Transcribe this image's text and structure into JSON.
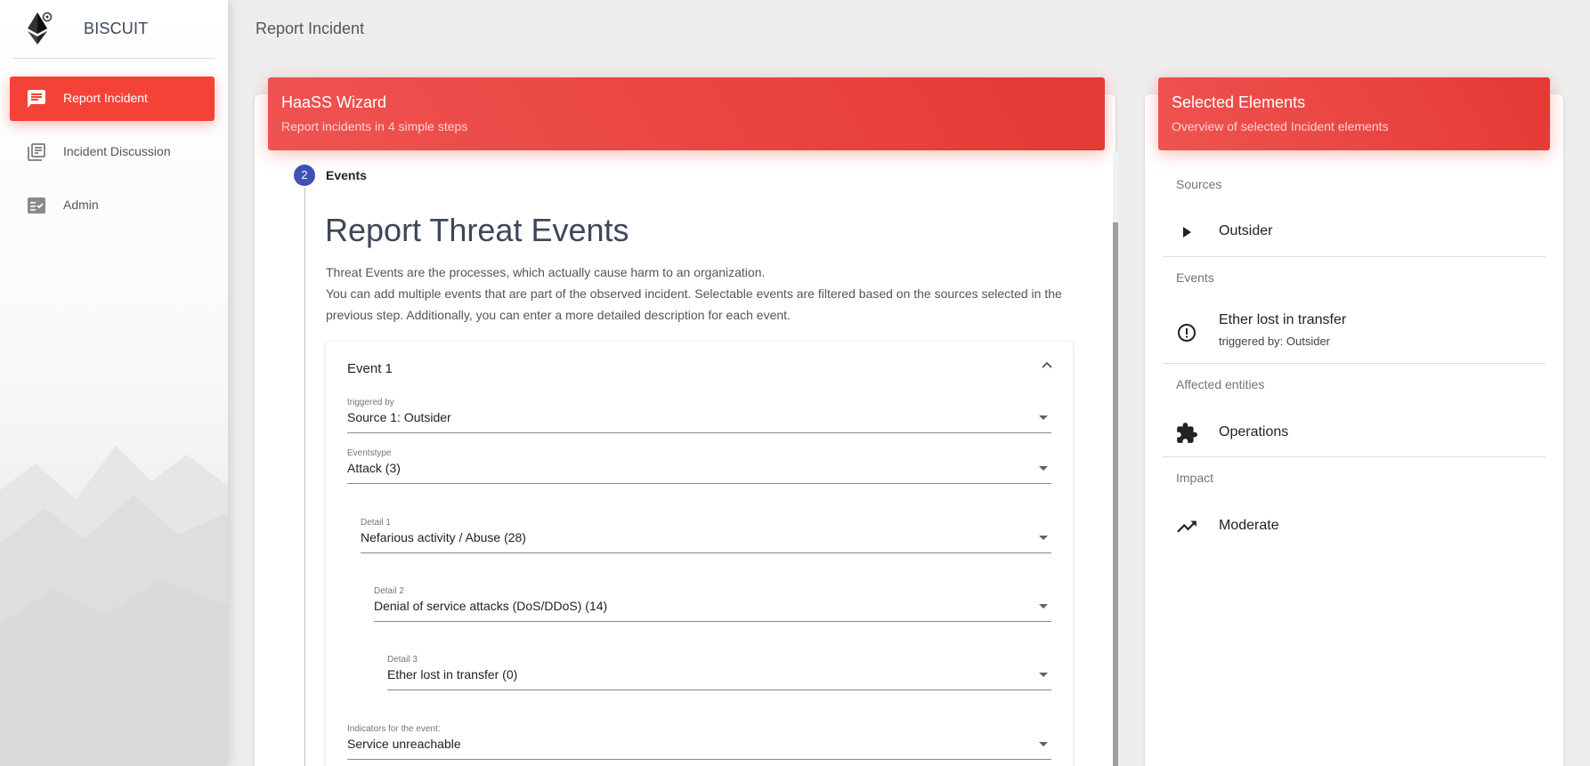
{
  "app": {
    "name": "BISCUIT"
  },
  "sidebar": {
    "items": [
      {
        "label": "Report Incident",
        "icon": "chat-icon",
        "active": true
      },
      {
        "label": "Incident Discussion",
        "icon": "library-books-icon",
        "active": false
      },
      {
        "label": "Admin",
        "icon": "checklist-icon",
        "active": false
      }
    ]
  },
  "topbar": {
    "title": "Report Incident"
  },
  "wizard": {
    "title": "HaaSS Wizard",
    "subtitle": "Report incidents in 4 simple steps",
    "step": {
      "number": "2",
      "label": "Events"
    },
    "heading": "Report Threat Events",
    "description": [
      "Threat Events are the processes, which actually cause harm to an organization.",
      "You can add multiple events that are part of the observed incident. Selectable events are filtered based on the sources selected in the",
      "previous step. Additionally, you can enter a more detailed description for each event."
    ],
    "event": {
      "title": "Event 1",
      "fields": {
        "triggered_by": {
          "label": "triggered by",
          "value": "Source 1: Outsider"
        },
        "eventstype": {
          "label": "Eventstype",
          "value": "Attack (3)"
        },
        "detail1": {
          "label": "Detail 1",
          "value": "Nefarious activity / Abuse (28)"
        },
        "detail2": {
          "label": "Detail 2",
          "value": "Denial of service attacks (DoS/DDoS) (14)"
        },
        "detail3": {
          "label": "Detail 3",
          "value": "Ether lost in transfer (0)"
        },
        "indicators": {
          "label": "Indicators for the event:",
          "value": "Service unreachable"
        }
      }
    }
  },
  "selected": {
    "title": "Selected Elements",
    "subtitle": "Overview of selected Incident elements",
    "sections": {
      "sources": {
        "title": "Sources",
        "item": "Outsider",
        "icon": "play-arrow-icon"
      },
      "events": {
        "title": "Events",
        "item": "Ether lost in transfer",
        "sub": "triggered by: Outsider",
        "icon": "error-outline-icon"
      },
      "affected": {
        "title": "Affected entities",
        "item": "Operations",
        "icon": "extension-icon"
      },
      "impact": {
        "title": "Impact",
        "item": "Moderate",
        "icon": "trending-up-icon"
      }
    }
  },
  "colors": {
    "accent": "#f44336",
    "step": "#3f51b5"
  }
}
